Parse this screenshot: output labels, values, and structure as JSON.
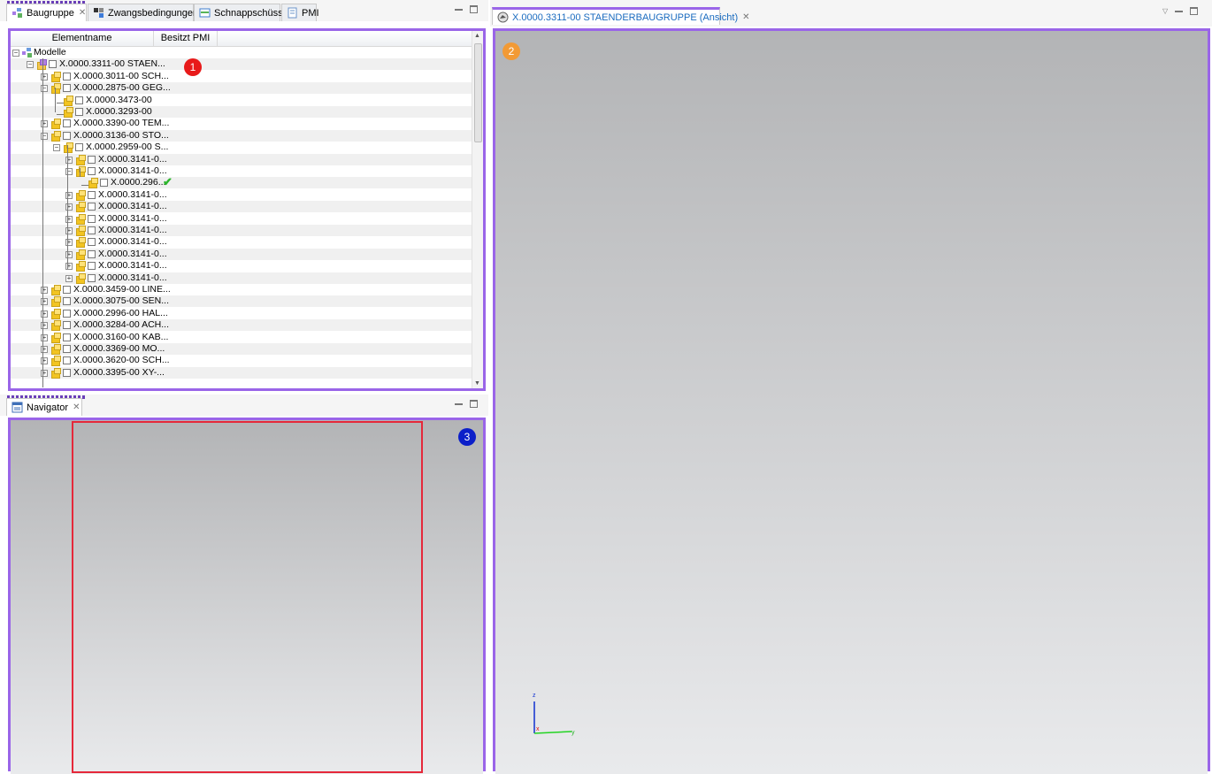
{
  "left_tabs": [
    {
      "label": "Baugruppe",
      "active": true,
      "icon": "assembly-icon"
    },
    {
      "label": "Zwangsbedingungen",
      "active": false,
      "icon": "constraints-icon"
    },
    {
      "label": "Schnappschüsse",
      "active": false,
      "icon": "snapshot-icon"
    },
    {
      "label": "PMI",
      "active": false,
      "icon": "pmi-icon"
    }
  ],
  "tree": {
    "columns": [
      "Elementname",
      "Besitzt PMI"
    ],
    "rows": [
      {
        "label": "Modelle",
        "depth": 0
      },
      {
        "label": "X.0000.3311-00 STAEN...",
        "depth": 1
      },
      {
        "label": "X.0000.3011-00 SCH...",
        "depth": 2
      },
      {
        "label": "X.0000.2875-00 GEG...",
        "depth": 2
      },
      {
        "label": "X.0000.3473-00",
        "depth": 3
      },
      {
        "label": "X.0000.3293-00",
        "depth": 3
      },
      {
        "label": "X.0000.3390-00 TEM...",
        "depth": 2
      },
      {
        "label": "X.0000.3136-00 STO...",
        "depth": 2
      },
      {
        "label": "X.0000.2959-00 S...",
        "depth": 3
      },
      {
        "label": "X.0000.3141-0...",
        "depth": 4
      },
      {
        "label": "X.0000.3141-0...",
        "depth": 4
      },
      {
        "label": "X.0000.296...",
        "depth": 5,
        "has_pmi": true
      },
      {
        "label": "X.0000.3141-0...",
        "depth": 4
      },
      {
        "label": "X.0000.3141-0...",
        "depth": 4
      },
      {
        "label": "X.0000.3141-0...",
        "depth": 4
      },
      {
        "label": "X.0000.3141-0...",
        "depth": 4
      },
      {
        "label": "X.0000.3141-0...",
        "depth": 4
      },
      {
        "label": "X.0000.3141-0...",
        "depth": 4
      },
      {
        "label": "X.0000.3141-0...",
        "depth": 4
      },
      {
        "label": "X.0000.3141-0...",
        "depth": 4
      },
      {
        "label": "X.0000.3459-00 LINE...",
        "depth": 2
      },
      {
        "label": "X.0000.3075-00 SEN...",
        "depth": 2
      },
      {
        "label": "X.0000.2996-00 HAL...",
        "depth": 2
      },
      {
        "label": "X.0000.3284-00 ACH...",
        "depth": 2
      },
      {
        "label": "X.0000.3160-00 KAB...",
        "depth": 2
      },
      {
        "label": "X.0000.3369-00 MO...",
        "depth": 2
      },
      {
        "label": "X.0000.3620-00 SCH...",
        "depth": 2
      },
      {
        "label": "X.0000.3395-00 XY-...",
        "depth": 2
      }
    ]
  },
  "navigator_tab": {
    "label": "Navigator",
    "icon": "navigator-icon"
  },
  "view_tab": {
    "label": "X.0000.3311-00 STAENDERBAUGRUPPE (Ansicht)",
    "icon": "view-icon"
  },
  "badges": {
    "tree": "1",
    "view": "2",
    "navigator": "3"
  },
  "axis": {
    "z": "z",
    "y": "y",
    "x": "x"
  },
  "colors": {
    "frame": "#9a65e8",
    "badge1": "#e81a1a",
    "badge2": "#f29a35",
    "badge3": "#0c1fc9",
    "nav_rect": "#e5283a"
  }
}
